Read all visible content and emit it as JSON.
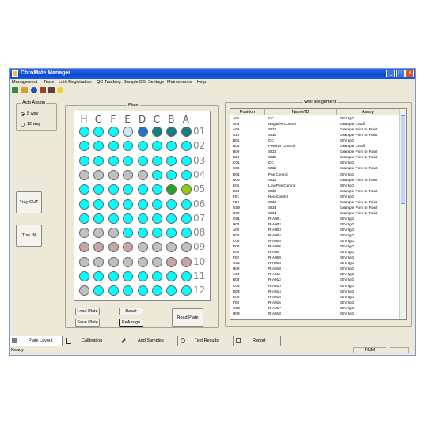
{
  "window": {
    "title": "ChroMate Manager"
  },
  "menu": [
    "Management",
    "Tests",
    "Lot# Registration",
    "QC Tracking",
    "Sample DB",
    "Settings",
    "Maintenance",
    "Help"
  ],
  "auto_assign": {
    "label": "Auto Assign",
    "options": [
      "8 way",
      "12 way"
    ],
    "selected": "8 way"
  },
  "tray_buttons": {
    "out": "Tray OUT",
    "in": "Tray IN"
  },
  "plate": {
    "label": "Plate:",
    "columns": [
      "H",
      "G",
      "F",
      "E",
      "D",
      "C",
      "B",
      "A"
    ],
    "rows": [
      "01",
      "02",
      "03",
      "04",
      "05",
      "06",
      "07",
      "08",
      "09",
      "10",
      "11",
      "12"
    ],
    "wells": [
      [
        "cyan",
        "cyan",
        "cyan",
        "lightblue",
        "blue",
        "teal",
        "teal",
        "teal"
      ],
      [
        "cyan",
        "cyan",
        "cyan",
        "cyan",
        "cyan",
        "cyan",
        "cyan",
        "cyan"
      ],
      [
        "cyan",
        "cyan",
        "cyan",
        "cyan",
        "cyan",
        "cyan",
        "cyan",
        "cyan"
      ],
      [
        "grey",
        "grey",
        "grey",
        "grey",
        "grey",
        "cyan",
        "cyan",
        "cyan"
      ],
      [
        "cyan",
        "cyan",
        "cyan",
        "cyan",
        "cyan",
        "cyan",
        "green",
        "lime"
      ],
      [
        "cyan",
        "cyan",
        "cyan",
        "cyan",
        "cyan",
        "cyan",
        "cyan",
        "cyan"
      ],
      [
        "cyan",
        "cyan",
        "cyan",
        "cyan",
        "cyan",
        "cyan",
        "cyan",
        "cyan"
      ],
      [
        "grey",
        "grey",
        "grey",
        "cyan",
        "cyan",
        "cyan",
        "cyan",
        "cyan"
      ],
      [
        "pink",
        "pink",
        "pink",
        "pink",
        "grey",
        "grey",
        "grey",
        "grey"
      ],
      [
        "grey",
        "grey",
        "grey",
        "grey",
        "grey",
        "grey",
        "pink",
        "pink"
      ],
      [
        "cyan",
        "cyan",
        "cyan",
        "cyan",
        "cyan",
        "cyan",
        "cyan",
        "cyan"
      ],
      [
        "grey",
        "cyan",
        "cyan",
        "cyan",
        "cyan",
        "cyan",
        "cyan",
        "cyan"
      ]
    ]
  },
  "plate_buttons": {
    "load": "Load Plate",
    "save": "Save Plate",
    "reset": "Reset",
    "reassign": "ReAssign",
    "read": "Read Plate"
  },
  "well_assignment": {
    "label": "Well assignment",
    "headers": [
      "Position",
      "Name/ID",
      "Assay"
    ],
    "rows": [
      [
        "A01",
        "CC",
        "EBV IgG"
      ],
      [
        "A05",
        "Negative Control",
        "Example Cutoff"
      ],
      [
        "A09",
        "Std1",
        "Example Point to Point"
      ],
      [
        "A10",
        "Std5",
        "Example Point to Point"
      ],
      [
        "B01",
        "CC",
        "EBV IgG"
      ],
      [
        "B05",
        "Positive Control",
        "Example Cutoff"
      ],
      [
        "B09",
        "Std1",
        "Example Point to Point"
      ],
      [
        "B10",
        "Std5",
        "Example Point to Point"
      ],
      [
        "C01",
        "CC",
        "EBV IgG"
      ],
      [
        "C09",
        "Std2",
        "Example Point to Point"
      ],
      [
        "D01",
        "Pos Control",
        "EBV IgG"
      ],
      [
        "D09",
        "Std2",
        "Example Point to Point"
      ],
      [
        "E01",
        "Low Pos Control",
        "EBV IgG"
      ],
      [
        "E09",
        "Std3",
        "Example Point to Point"
      ],
      [
        "F01",
        "Neg Control",
        "EBV IgG"
      ],
      [
        "F09",
        "Std3",
        "Example Point to Point"
      ],
      [
        "G09",
        "Std4",
        "Example Point to Point"
      ],
      [
        "H09",
        "Std4",
        "Example Point to Point"
      ],
      [
        "G01",
        "R-A001",
        "EBV IgG"
      ],
      [
        "H01",
        "R-A002",
        "EBV IgG"
      ],
      [
        "A02",
        "R-A003",
        "EBV IgG"
      ],
      [
        "B02",
        "R-A004",
        "EBV IgG"
      ],
      [
        "C02",
        "R-A005",
        "EBV IgG"
      ],
      [
        "D02",
        "R-A006",
        "EBV IgG"
      ],
      [
        "E02",
        "R-A007",
        "EBV IgG"
      ],
      [
        "F02",
        "R-A008",
        "EBV IgG"
      ],
      [
        "G02",
        "R-A009",
        "EBV IgG"
      ],
      [
        "H02",
        "R-A010",
        "EBV IgG"
      ],
      [
        "A03",
        "R-A011",
        "EBV IgG"
      ],
      [
        "B03",
        "R-A012",
        "EBV IgG"
      ],
      [
        "C03",
        "R-A013",
        "EBV IgG"
      ],
      [
        "D03",
        "R-A014",
        "EBV IgG"
      ],
      [
        "E03",
        "R-A015",
        "EBV IgG"
      ],
      [
        "F03",
        "R-A016",
        "EBV IgG"
      ],
      [
        "G03",
        "R-A017",
        "EBV IgG"
      ],
      [
        "H03",
        "R-A018",
        "EBV IgG"
      ]
    ]
  },
  "tabs": [
    "Plate Layout",
    "Calibration",
    "Add Samples",
    "Test Results",
    "Report"
  ],
  "status": {
    "left": "Ready",
    "num": "NUM"
  },
  "colors": {
    "title_bar": "#0a48d2",
    "well_cyan": "#00ffff",
    "well_grey": "#c0c0c0",
    "well_pink": "#c9a5a5",
    "well_teal": "#108080",
    "well_blue": "#2070d8",
    "well_green": "#28a028",
    "well_lime": "#90cc10"
  }
}
